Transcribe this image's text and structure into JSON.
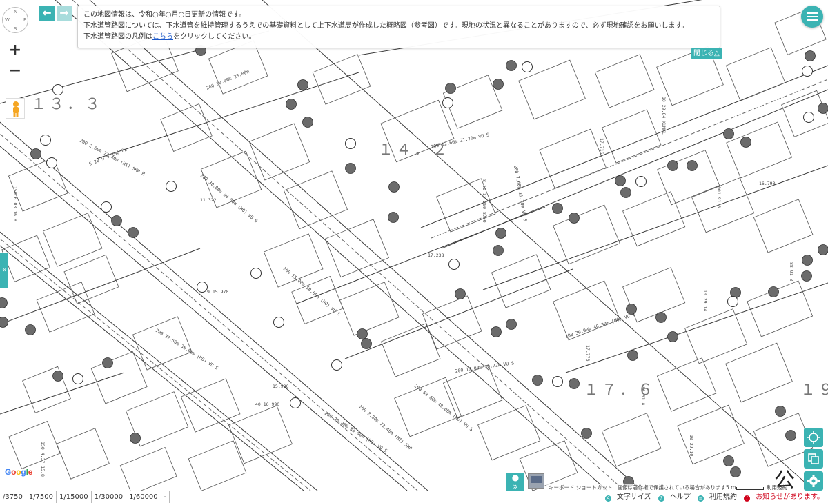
{
  "notice": {
    "line1": "この地図情報は、令和○年○月○日更新の情報です。",
    "line2": "下水道管路図については、下水道管を維持管理するうえでの基礎資料として上下水道局が作成した概略図（参考図）です。現地の状況と異なることがありますので、必ず現地確認をお願いします。",
    "line3_prefix": "下水道管路図の凡例は",
    "line3_link": "こちら",
    "line3_suffix": "をクリックしてください。",
    "close_label": "閉じる△"
  },
  "map": {
    "block_labels": [
      "１３．３",
      "１４．２",
      "１７．６",
      "１９"
    ],
    "pipe_labels": [
      "200 2.80‰ 73.40m (H1) SHP H",
      "200 30.00‰ 38.00m (HO) VU S",
      "200 37.50‰ 38.00m (HO) VU S",
      "200 12.60‰ 21.70m VU S",
      "200 30.00‰ 40.80m (HO) VU S",
      "200 7.60‰ 31.70m VU S",
      "200 25.00‰ 33.00m (HO) VU S",
      "200 17.00‰ 30.72m VU S",
      "200 63.60‰ 49.00m (HO) VU S",
      "200 15.00‰ 50.00m (HO) VU S",
      "200 2.80‰ 73.40m (H1) SHP"
    ],
    "elevation_labels": [
      "9 15.970",
      "40 16.990",
      "17.238",
      "15.980",
      "16.790",
      "11.322"
    ],
    "corner_label": "公"
  },
  "nav": {
    "back_icon": "←",
    "forward_icon": "→",
    "zoom_in": "+",
    "zoom_out": "−",
    "side_tab": "«"
  },
  "compass": {
    "n": "N",
    "s": "S",
    "e": "E",
    "w": "W"
  },
  "google": {
    "letters": [
      "G",
      "o",
      "o",
      "g",
      "l",
      "e"
    ],
    "colors": [
      "#4285F4",
      "#EA4335",
      "#FBBC05",
      "#4285F4",
      "#34A853",
      "#EA4335"
    ]
  },
  "attribution": {
    "shortcut": "キーボード ショートカット",
    "copyright": "画像は著作権で保護されている場合があります",
    "scale": "5 m",
    "terms": "利用規約"
  },
  "scales": [
    "/3750",
    "1/7500",
    "1/15000",
    "1/30000",
    "1/60000",
    "-"
  ],
  "footer": {
    "font_size": "文字サイズ",
    "help": "ヘルプ",
    "terms": "利用規約",
    "alert": "お知らせがあります。"
  },
  "colors": {
    "accent": "#3bb3b3",
    "alert": "#d0021b",
    "link": "#1a57c9"
  }
}
